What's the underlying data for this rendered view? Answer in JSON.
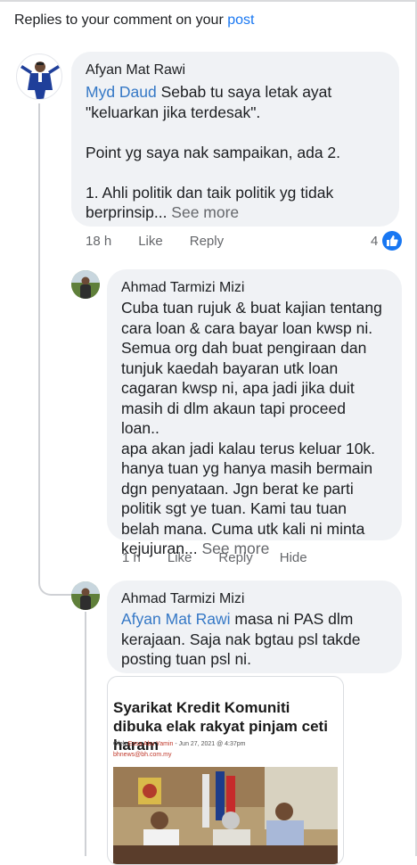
{
  "header": {
    "prefix": "Replies to your comment on your ",
    "link": "post"
  },
  "comments": [
    {
      "author": "Afyan Mat Rawi",
      "mention": "Myd Daud",
      "text": " Sebab tu saya letak ayat\n\"keluarkan jika terdesak\".\n\nPoint yg saya nak sampaikan, ada 2.\n\n1. Ahli politik dan taik politik yg tidak\nberprinsip...",
      "see_more": " See more",
      "time": "18 h",
      "like": "Like",
      "reply": "Reply",
      "like_count": "4"
    },
    {
      "author": "Ahmad Tarmizi Mizi",
      "text": "Cuba tuan rujuk & buat kajian tentang\ncara loan & cara bayar loan kwsp ni.\nSemua org dah buat pengiraan dan\ntunjuk kaedah bayaran utk loan\ncagaran kwsp ni, apa jadi jika duit\nmasih di dlm akaun tapi proceed loan..\napa akan jadi kalau terus keluar 10k.\nhanya tuan yg hanya masih bermain\ndgn penyataan. Jgn berat ke parti\npolitik sgt ye tuan. Kami tau tuan\nbelah mana. Cuma utk kali ni minta\nkejujuran...",
      "see_more": " See more",
      "time": "1 h",
      "like": "Like",
      "reply": "Reply",
      "hide": "Hide"
    },
    {
      "author": "Ahmad Tarmizi Mizi",
      "mention": "Afyan Mat Rawi",
      "text": " masa ni PAS dlm\nkerajaan. Saja nak bgtau psl takde\nposting tuan psl ni."
    }
  ],
  "article": {
    "title": "Syarikat Kredit Komuniti dibuka elak rakyat pinjam ceti haram",
    "meta_prefix": "Oleh ",
    "author": "Essa Abu Yamin",
    "meta_date": " - Jun 27, 2021 @ 4:37pm",
    "source": "bhnews@bh.com.my"
  },
  "colors": {
    "link": "#1877f2",
    "mention": "#3578c6",
    "bubble": "#f0f2f5",
    "meta": "#65676b"
  },
  "icons": [
    "like-thumb-icon"
  ]
}
